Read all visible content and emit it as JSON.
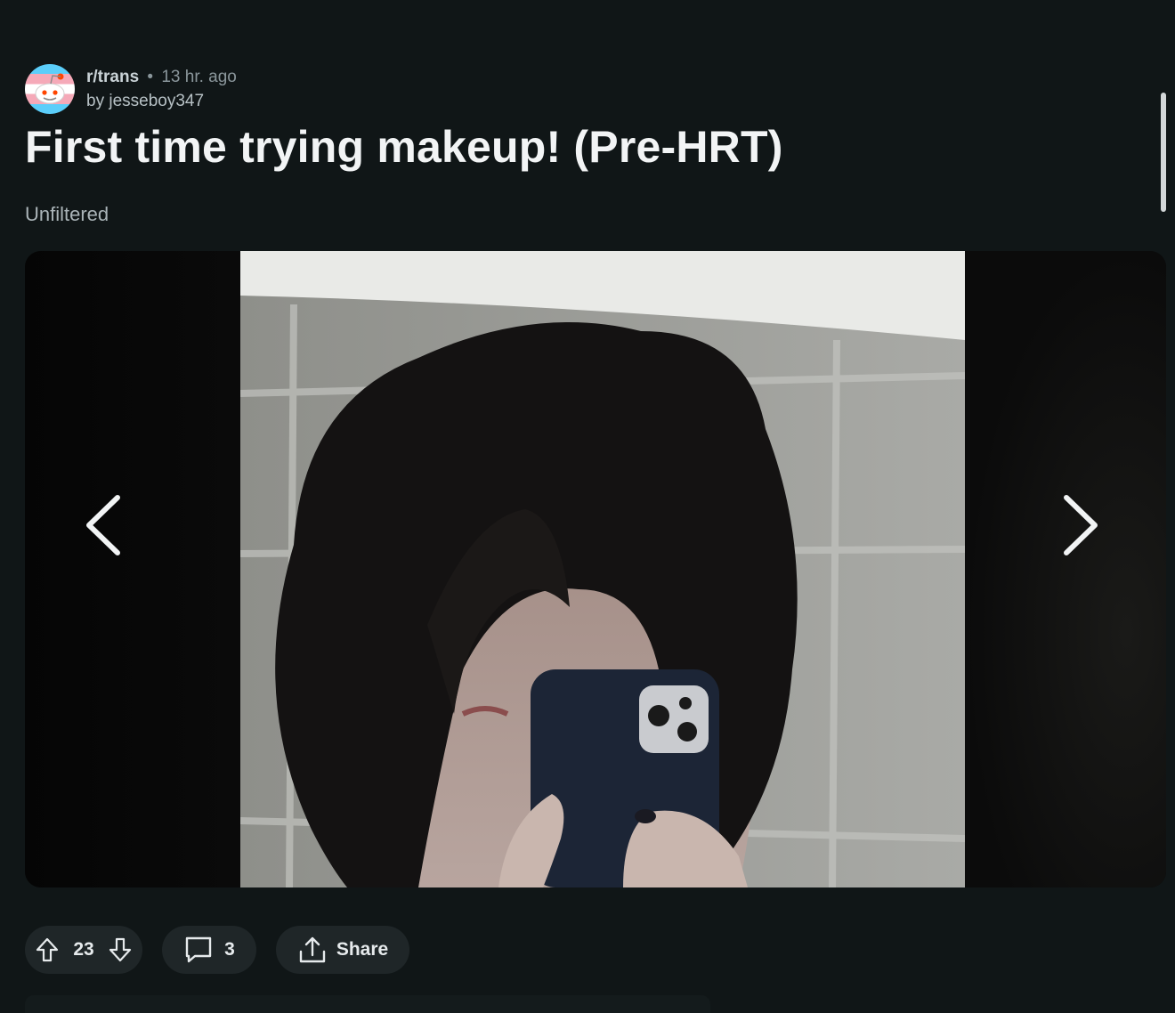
{
  "post": {
    "subreddit": "r/trans",
    "separator": "•",
    "time": "13 hr. ago",
    "author": "by jesseboy347",
    "title": "First time trying makeup! (Pre-HRT)",
    "flair": "Unfiltered"
  },
  "gallery": {
    "prev_icon": "chevron-left-icon",
    "next_icon": "chevron-right-icon"
  },
  "actions": {
    "votes": "23",
    "comments": "3",
    "share_label": "Share"
  },
  "colors": {
    "background": "#101617",
    "pill": "#1f2628",
    "text": "#e6eaec"
  }
}
